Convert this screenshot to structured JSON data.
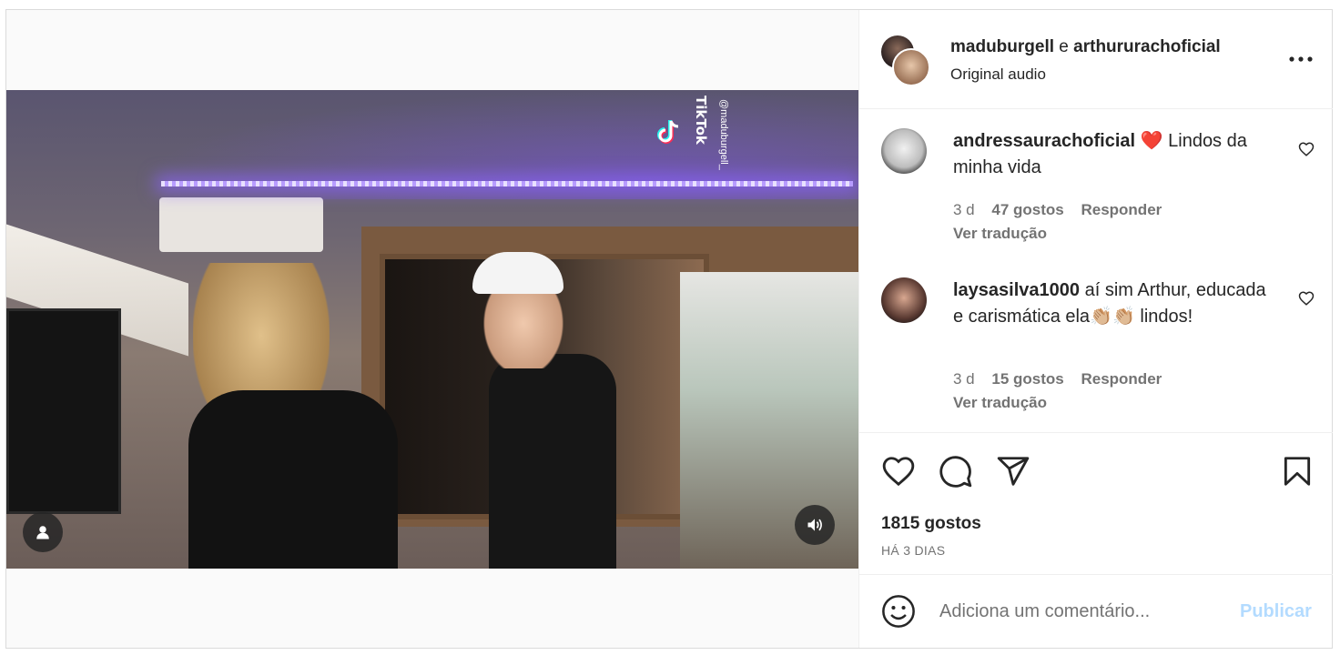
{
  "header": {
    "user1": "maduburgell",
    "connector": "e",
    "user2": "arthururachoficial",
    "subtitle": "Original audio",
    "more_icon": "more-horizontal-icon"
  },
  "video": {
    "watermark_brand": "TikTok",
    "watermark_user": "@maduburgell_",
    "user_tag_icon": "user-icon",
    "sound_icon": "volume-icon"
  },
  "comments": [
    {
      "username": "andressaurachoficial",
      "emoji": "❤️",
      "text": "Lindos da minha vida",
      "time": "3 d",
      "likes": "47 gostos",
      "reply": "Responder",
      "translate": "Ver tradução"
    },
    {
      "username": "laysasilva1000",
      "text": "aí sim Arthur, educada e carismática ela👏🏼👏🏼 lindos!",
      "time": "3 d",
      "likes": "15 gostos",
      "reply": "Responder",
      "translate": "Ver tradução"
    }
  ],
  "actions": {
    "like_icon": "heart-icon",
    "comment_icon": "comment-icon",
    "share_icon": "send-icon",
    "save_icon": "bookmark-icon",
    "likes_count": "1815 gostos",
    "date": "HÁ 3 DIAS"
  },
  "add_comment": {
    "emoji_icon": "emoji-icon",
    "placeholder": "Adiciona um comentário...",
    "publish_label": "Publicar"
  },
  "colors": {
    "text": "#262626",
    "secondary": "#737373",
    "publish_disabled": "#b3dbff",
    "border": "#dbdbdb"
  }
}
